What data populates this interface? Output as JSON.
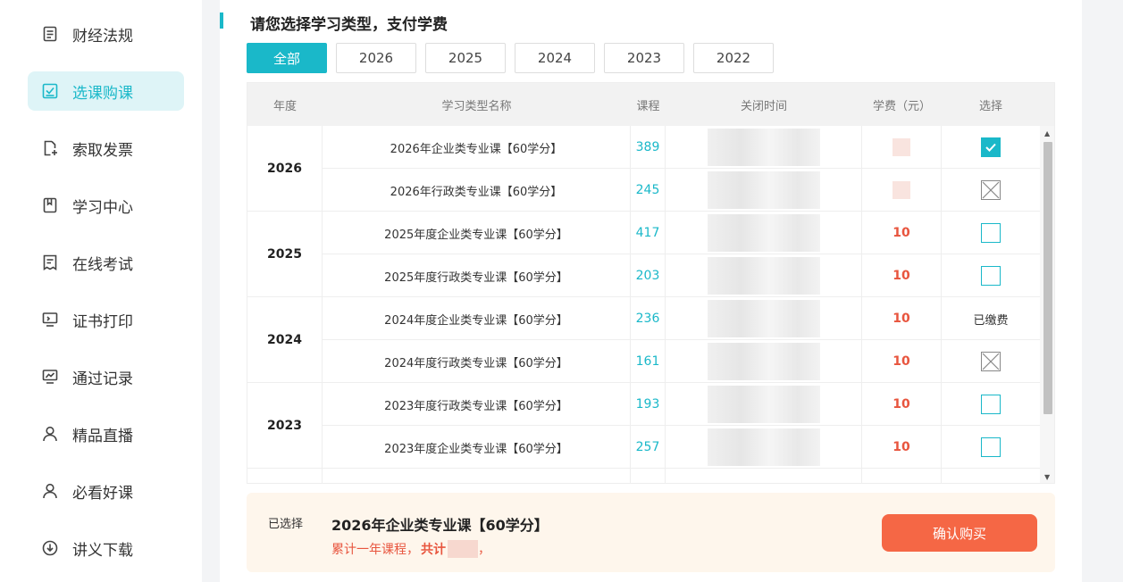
{
  "sidebar": {
    "items": [
      {
        "label": "财经法规",
        "icon": "document-icon",
        "active": false
      },
      {
        "label": "选课购课",
        "icon": "checklist-icon",
        "active": true
      },
      {
        "label": "索取发票",
        "icon": "invoice-add-icon",
        "active": false
      },
      {
        "label": "学习中心",
        "icon": "bookmark-icon",
        "active": false
      },
      {
        "label": "在线考试",
        "icon": "exam-paper-icon",
        "active": false
      },
      {
        "label": "证书打印",
        "icon": "monitor-icon",
        "active": false
      },
      {
        "label": "通过记录",
        "icon": "chart-monitor-icon",
        "active": false
      },
      {
        "label": "精品直播",
        "icon": "user-icon",
        "active": false
      },
      {
        "label": "必看好课",
        "icon": "user-icon",
        "active": false
      },
      {
        "label": "讲义下载",
        "icon": "download-circle-icon",
        "active": false
      }
    ]
  },
  "main": {
    "title": "请您选择学习类型，支付学费",
    "tabs": [
      "全部",
      "2026",
      "2025",
      "2024",
      "2023",
      "2022"
    ],
    "active_tab": 0,
    "table": {
      "headers": [
        "年度",
        "学习类型名称",
        "课程",
        "关闭时间",
        "学费（元）",
        "选择"
      ],
      "groups": [
        {
          "year": "2026",
          "rows": [
            {
              "name": "2026年企业类专业课【60学分】",
              "count": "389",
              "fee": "",
              "select": "checked"
            },
            {
              "name": "2026年行政类专业课【60学分】",
              "count": "245",
              "fee": "",
              "select": "disabled"
            }
          ]
        },
        {
          "year": "2025",
          "rows": [
            {
              "name": "2025年度企业类专业课【60学分】",
              "count": "417",
              "fee": "10",
              "select": "unchecked"
            },
            {
              "name": "2025年度行政类专业课【60学分】",
              "count": "203",
              "fee": "10",
              "select": "unchecked"
            }
          ]
        },
        {
          "year": "2024",
          "rows": [
            {
              "name": "2024年度企业类专业课【60学分】",
              "count": "236",
              "fee": "10",
              "select": "paid",
              "select_text": "已缴费"
            },
            {
              "name": "2024年度行政类专业课【60学分】",
              "count": "161",
              "fee": "10",
              "select": "disabled"
            }
          ]
        },
        {
          "year": "2023",
          "rows": [
            {
              "name": "2023年度行政类专业课【60学分】",
              "count": "193",
              "fee": "10",
              "select": "unchecked"
            },
            {
              "name": "2023年度企业类专业课【60学分】",
              "count": "257",
              "fee": "10",
              "select": "unchecked"
            }
          ]
        }
      ]
    }
  },
  "summary": {
    "label": "已选择",
    "selected": "2026年企业类专业课【60学分】",
    "desc_prefix": "累计一年课程，",
    "desc_bold": "共计",
    "desc_suffix": "，",
    "confirm_label": "确认购买"
  },
  "colors": {
    "accent": "#1ab8c9",
    "fee": "#e8553e",
    "confirm": "#f56745"
  }
}
